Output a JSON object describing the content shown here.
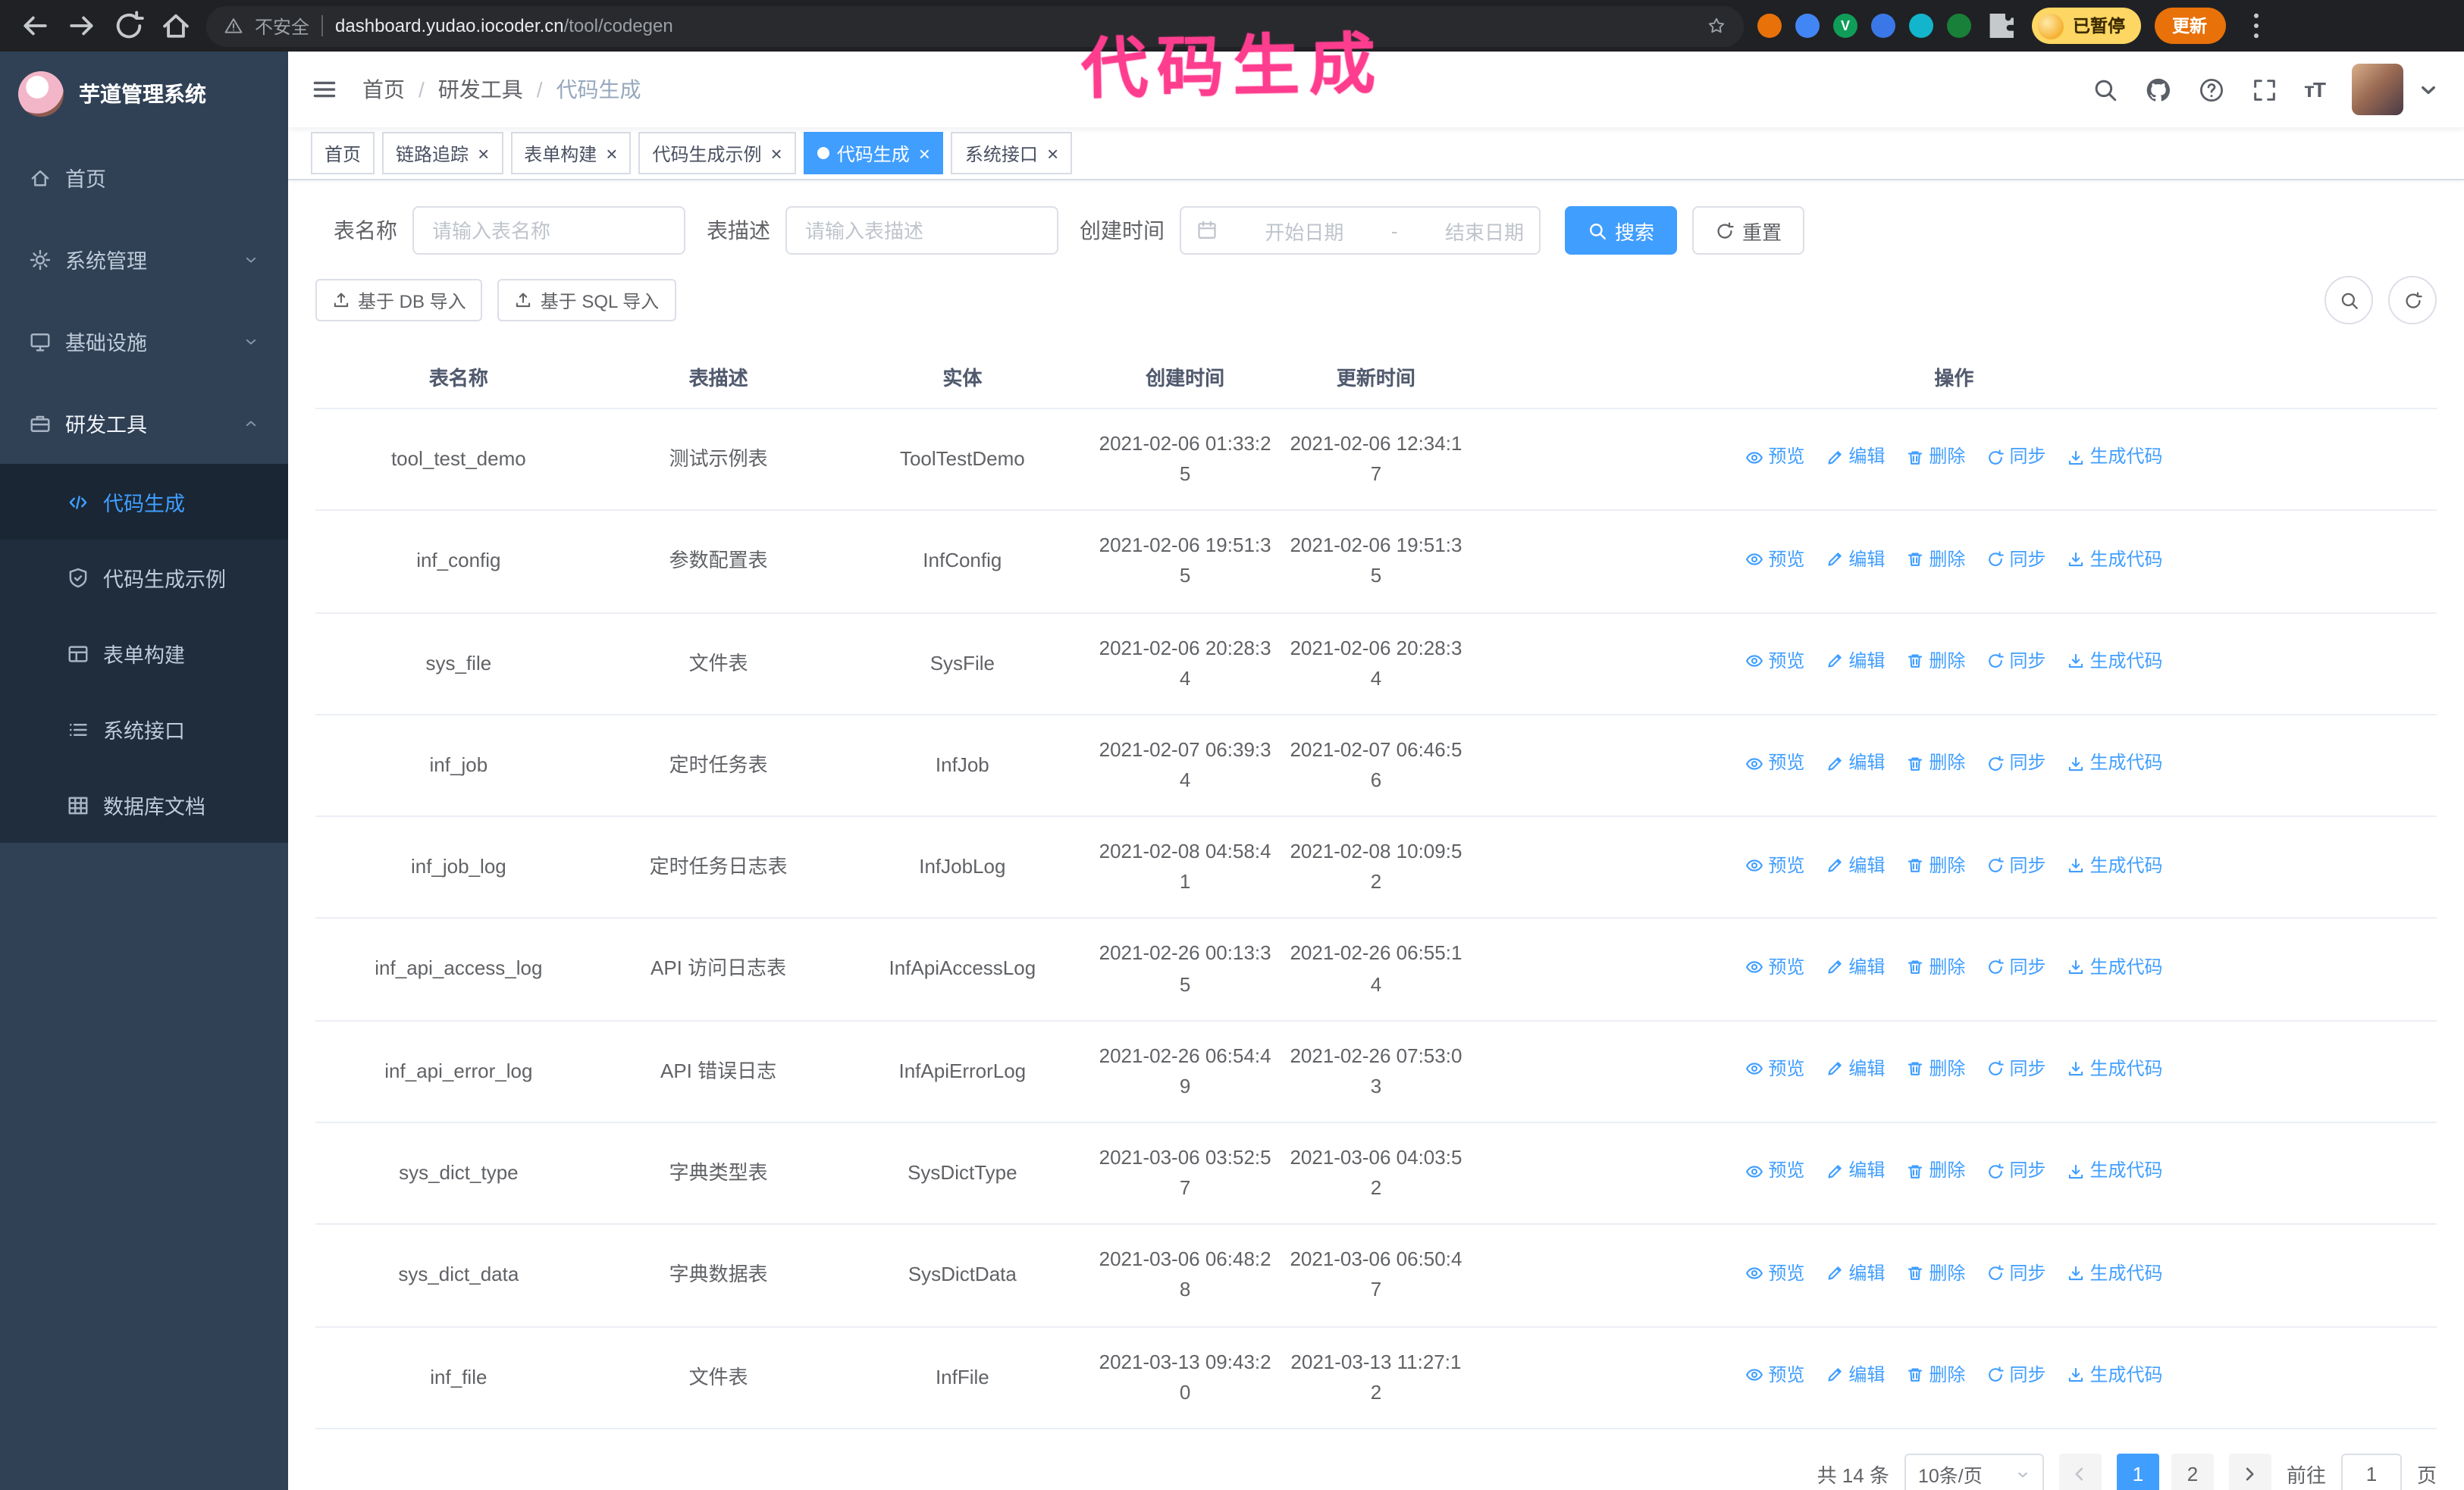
{
  "colors": {
    "accent": "#409eff",
    "sidebar_bg": "#304156",
    "submenu_bg": "#1f2d3d",
    "annotation_pink": "#ff3d8f",
    "chrome_bar": "#202124"
  },
  "browser": {
    "security_label": "不安全",
    "url_host": "dashboard.yudao.iocoder.cn",
    "url_path": "/tool/codegen",
    "paused_badge": "已暂停",
    "update_button": "更新",
    "extensions": [
      {
        "name": "extension-icon-orange",
        "color": "#e8710a"
      },
      {
        "name": "extension-icon-blue",
        "color": "#4285f4"
      },
      {
        "name": "extension-icon-green-v",
        "color": "#0f9d58",
        "letter": "V"
      },
      {
        "name": "extension-icon-people",
        "color": "#3b78e7"
      },
      {
        "name": "extension-icon-teal",
        "color": "#12b5cb"
      },
      {
        "name": "extension-icon-leaf",
        "color": "#188038"
      }
    ]
  },
  "annotation": {
    "text": "代码生成"
  },
  "sidebar": {
    "logo_title": "芋道管理系统",
    "items": [
      {
        "label": "首页"
      },
      {
        "label": "系统管理"
      },
      {
        "label": "基础设施"
      },
      {
        "label": "研发工具"
      }
    ],
    "submenu": [
      {
        "label": "代码生成",
        "active": true
      },
      {
        "label": "代码生成示例"
      },
      {
        "label": "表单构建"
      },
      {
        "label": "系统接口"
      },
      {
        "label": "数据库文档"
      }
    ]
  },
  "header": {
    "breadcrumb": [
      "首页",
      "研发工具",
      "代码生成"
    ]
  },
  "tags": [
    {
      "label": "首页",
      "closable": false,
      "active": false
    },
    {
      "label": "链路追踪",
      "closable": true,
      "active": false
    },
    {
      "label": "表单构建",
      "closable": true,
      "active": false
    },
    {
      "label": "代码生成示例",
      "closable": true,
      "active": false
    },
    {
      "label": "代码生成",
      "closable": true,
      "active": true
    },
    {
      "label": "系统接口",
      "closable": true,
      "active": false
    }
  ],
  "filters": {
    "table_name_label": "表名称",
    "table_name_placeholder": "请输入表名称",
    "table_desc_label": "表描述",
    "table_desc_placeholder": "请输入表描述",
    "create_time_label": "创建时间",
    "date_start_placeholder": "开始日期",
    "date_separator": "-",
    "date_end_placeholder": "结束日期",
    "search_button": "搜索",
    "reset_button": "重置"
  },
  "toolbar": {
    "import_db": "基于 DB 导入",
    "import_sql": "基于 SQL 导入"
  },
  "table": {
    "columns": [
      "表名称",
      "表描述",
      "实体",
      "创建时间",
      "更新时间",
      "操作"
    ],
    "actions": [
      "预览",
      "编辑",
      "删除",
      "同步",
      "生成代码"
    ],
    "rows": [
      {
        "name": "tool_test_demo",
        "desc": "测试示例表",
        "entity": "ToolTestDemo",
        "created": "2021-02-06 01:33:25",
        "updated": "2021-02-06 12:34:17"
      },
      {
        "name": "inf_config",
        "desc": "参数配置表",
        "entity": "InfConfig",
        "created": "2021-02-06 19:51:35",
        "updated": "2021-02-06 19:51:35"
      },
      {
        "name": "sys_file",
        "desc": "文件表",
        "entity": "SysFile",
        "created": "2021-02-06 20:28:34",
        "updated": "2021-02-06 20:28:34"
      },
      {
        "name": "inf_job",
        "desc": "定时任务表",
        "entity": "InfJob",
        "created": "2021-02-07 06:39:34",
        "updated": "2021-02-07 06:46:56"
      },
      {
        "name": "inf_job_log",
        "desc": "定时任务日志表",
        "entity": "InfJobLog",
        "created": "2021-02-08 04:58:41",
        "updated": "2021-02-08 10:09:52"
      },
      {
        "name": "inf_api_access_log",
        "desc": "API 访问日志表",
        "entity": "InfApiAccessLog",
        "created": "2021-02-26 00:13:35",
        "updated": "2021-02-26 06:55:14"
      },
      {
        "name": "inf_api_error_log",
        "desc": "API 错误日志",
        "entity": "InfApiErrorLog",
        "created": "2021-02-26 06:54:49",
        "updated": "2021-02-26 07:53:03"
      },
      {
        "name": "sys_dict_type",
        "desc": "字典类型表",
        "entity": "SysDictType",
        "created": "2021-03-06 03:52:57",
        "updated": "2021-03-06 04:03:52"
      },
      {
        "name": "sys_dict_data",
        "desc": "字典数据表",
        "entity": "SysDictData",
        "created": "2021-03-06 06:48:28",
        "updated": "2021-03-06 06:50:47"
      },
      {
        "name": "inf_file",
        "desc": "文件表",
        "entity": "InfFile",
        "created": "2021-03-13 09:43:20",
        "updated": "2021-03-13 11:27:12"
      }
    ]
  },
  "pagination": {
    "total": "共 14 条",
    "page_size": "10条/页",
    "pages": [
      "1",
      "2"
    ],
    "active_page": "1",
    "goto_label": "前往",
    "goto_value": "1",
    "goto_suffix": "页"
  }
}
